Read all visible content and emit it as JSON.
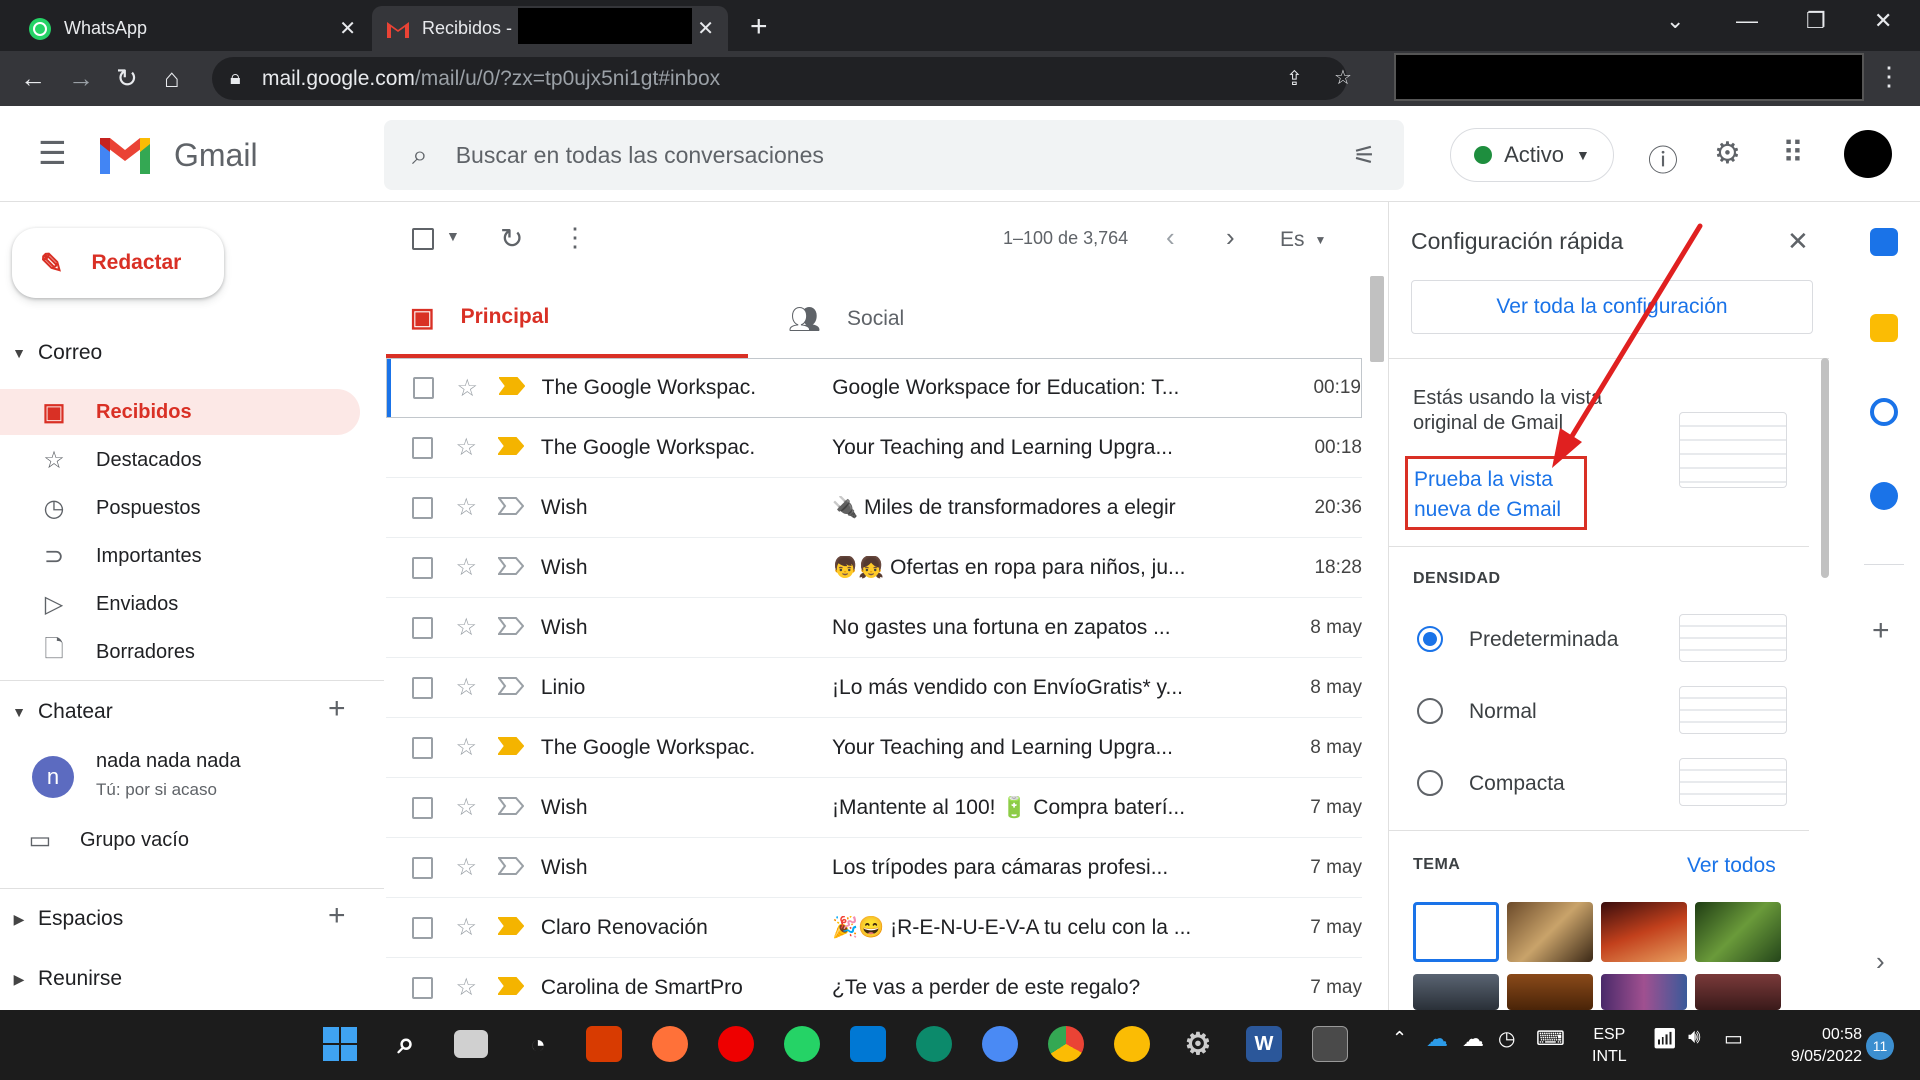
{
  "browser": {
    "tabs": [
      {
        "title": "WhatsApp"
      },
      {
        "title": "Recibidos -"
      }
    ],
    "url_host": "mail.google.com",
    "url_path": "/mail/u/0/?zx=tp0ujx5ni1gt#inbox"
  },
  "header": {
    "app_name": "Gmail",
    "search_placeholder": "Buscar en todas las conversaciones",
    "status": "Activo"
  },
  "sidebar": {
    "compose_label": "Redactar",
    "mail_section": "Correo",
    "items": [
      {
        "label": "Recibidos",
        "icon": "inbox-icon"
      },
      {
        "label": "Destacados",
        "icon": "star-icon"
      },
      {
        "label": "Pospuestos",
        "icon": "clock-icon"
      },
      {
        "label": "Importantes",
        "icon": "important-icon"
      },
      {
        "label": "Enviados",
        "icon": "send-icon"
      },
      {
        "label": "Borradores",
        "icon": "draft-icon"
      }
    ],
    "chat_section": "Chatear",
    "chat_user_initial": "n",
    "chat_user_name": "nada nada nada",
    "chat_user_status": "Tú: por si acaso",
    "chat_group": "Grupo vacío",
    "spaces_section": "Espacios",
    "meet_section": "Reunirse"
  },
  "main": {
    "pagination": "1–100 de 3,764",
    "lang_button": "Es",
    "tabs": [
      {
        "label": "Principal"
      },
      {
        "label": "Social"
      }
    ],
    "emails": [
      {
        "sender": "The Google Workspac.",
        "subject": "Google Workspace for Education: T...",
        "time": "00:19",
        "important": true
      },
      {
        "sender": "The Google Workspac.",
        "subject": "Your Teaching and Learning Upgra...",
        "time": "00:18",
        "important": true
      },
      {
        "sender": "Wish",
        "subject": "🔌 Miles de transformadores a elegir",
        "time": "20:36",
        "important": false
      },
      {
        "sender": "Wish",
        "subject": "👦👧 Ofertas en ropa para niños, ju...",
        "time": "18:28",
        "important": false
      },
      {
        "sender": "Wish",
        "subject": "No gastes una fortuna en zapatos ...",
        "time": "8 may",
        "important": false
      },
      {
        "sender": "Linio",
        "subject": "¡Lo más vendido con EnvíoGratis* y...",
        "time": "8 may",
        "important": false
      },
      {
        "sender": "The Google Workspac.",
        "subject": "Your Teaching and Learning Upgra...",
        "time": "8 may",
        "important": true
      },
      {
        "sender": "Wish",
        "subject": "¡Mantente al 100! 🔋 Compra baterí...",
        "time": "7 may",
        "important": false
      },
      {
        "sender": "Wish",
        "subject": "Los trípodes para cámaras profesi...",
        "time": "7 may",
        "important": false
      },
      {
        "sender": "Claro Renovación",
        "subject": "🎉😄 ¡R-E-N-U-E-V-A tu celu con la ...",
        "time": "7 may",
        "important": true
      },
      {
        "sender": "Carolina de SmartPro",
        "subject": "¿Te vas a perder de este regalo?",
        "time": "7 may",
        "important": true
      }
    ]
  },
  "quick_settings": {
    "title": "Configuración rápida",
    "all_settings": "Ver toda la configuración",
    "view_text_1": "Estás usando la vista",
    "view_text_2": "original de Gmail",
    "try_new_1": "Prueba la vista",
    "try_new_2": "nueva de Gmail",
    "density_label": "DENSIDAD",
    "density_options": [
      {
        "label": "Predeterminada",
        "selected": true
      },
      {
        "label": "Normal",
        "selected": false
      },
      {
        "label": "Compacta",
        "selected": false
      }
    ],
    "theme_label": "TEMA",
    "see_all": "Ver todos"
  },
  "taskbar": {
    "lang_1": "ESP",
    "lang_2": "INTL",
    "time": "00:58",
    "date": "9/05/2022",
    "notif_count": "11"
  },
  "colors": {
    "accent_red": "#d93025",
    "link_blue": "#1a73e8",
    "important_yellow": "#f4b400"
  }
}
